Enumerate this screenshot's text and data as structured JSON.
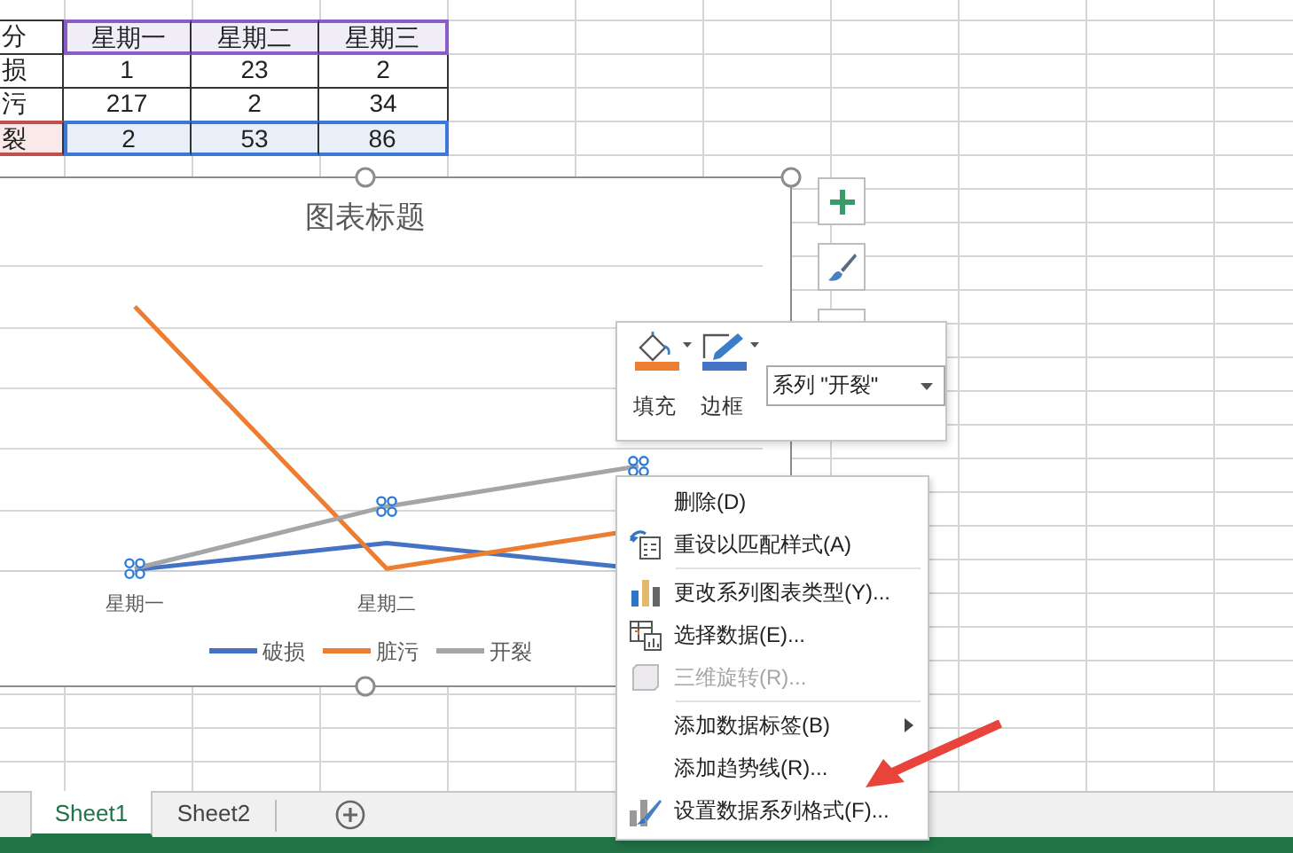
{
  "sheet": {
    "rows": [
      {
        "kind": "categories",
        "cells": [
          "分",
          "星期一",
          "星期二",
          "星期三"
        ]
      },
      {
        "kind": "plain",
        "cells": [
          "损",
          "1",
          "23",
          "2"
        ]
      },
      {
        "kind": "plain",
        "cells": [
          "污",
          "217",
          "2",
          "34"
        ]
      },
      {
        "kind": "selected",
        "cells": [
          "裂",
          "2",
          "53",
          "86"
        ]
      }
    ]
  },
  "chart": {
    "title": "图表标题",
    "category_labels": [
      "星期一",
      "星期二"
    ],
    "legend": [
      {
        "label": "破损",
        "color": "#4472c4",
        "selected": false
      },
      {
        "label": "脏污",
        "color": "#ed7d31",
        "selected": false
      },
      {
        "label": "开裂",
        "color": "#a5a5a5",
        "selected": true
      }
    ]
  },
  "mini_toolbar": {
    "buttons": [
      {
        "kind": "fill",
        "label": "填充"
      },
      {
        "kind": "border",
        "label": "边框"
      }
    ],
    "series_dropdown": "系列 \"开裂\""
  },
  "context_menu": {
    "items": [
      {
        "kind": "delete",
        "label": "删除(D)",
        "disabled": false,
        "submenu": false,
        "divider_above": false
      },
      {
        "kind": "reset",
        "label": "重设以匹配样式(A)",
        "disabled": false,
        "submenu": false,
        "divider_above": false
      },
      {
        "kind": "change-type",
        "label": "更改系列图表类型(Y)...",
        "disabled": false,
        "submenu": false,
        "divider_above": true
      },
      {
        "kind": "select-data",
        "label": "选择数据(E)...",
        "disabled": false,
        "submenu": false,
        "divider_above": false
      },
      {
        "kind": "rotate",
        "label": "三维旋转(R)...",
        "disabled": true,
        "submenu": false,
        "divider_above": false
      },
      {
        "kind": "labels",
        "label": "添加数据标签(B)",
        "disabled": false,
        "submenu": true,
        "divider_above": true
      },
      {
        "kind": "trendline",
        "label": "添加趋势线(R)...",
        "disabled": false,
        "submenu": false,
        "divider_above": false
      },
      {
        "kind": "format",
        "label": "设置数据系列格式(F)...",
        "disabled": false,
        "submenu": false,
        "divider_above": false
      }
    ]
  },
  "sheet_tabs": [
    {
      "label": "Sheet1",
      "selected": true
    },
    {
      "label": "Sheet2",
      "selected": false
    }
  ]
}
